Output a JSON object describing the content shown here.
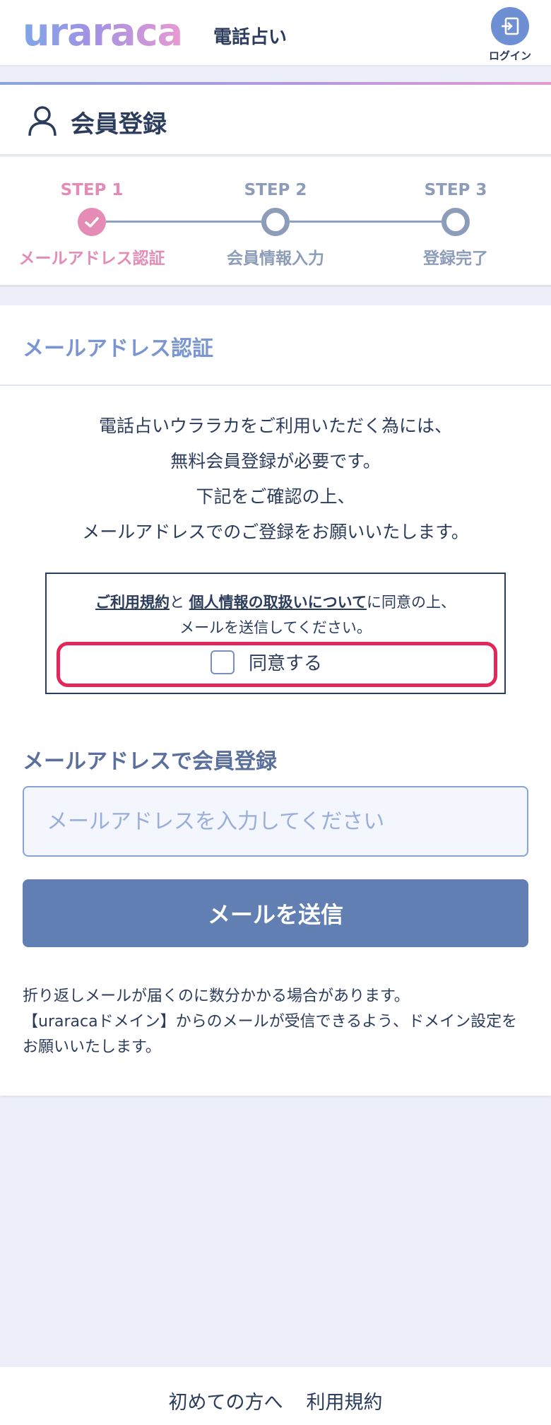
{
  "header": {
    "logo": "uraraca",
    "subtitle": "電話占い",
    "login_label": "ログイン"
  },
  "page_title": "会員登録",
  "steps": [
    {
      "title": "STEP 1",
      "name": "メールアドレス認証",
      "status": "done"
    },
    {
      "title": "STEP 2",
      "name": "会員情報入力",
      "status": "todo"
    },
    {
      "title": "STEP 3",
      "name": "登録完了",
      "status": "todo"
    }
  ],
  "section": {
    "heading": "メールアドレス認証",
    "intro": [
      "電話占いウララカをご利用いただく為には、",
      "無料会員登録が必要です。",
      "下記をご確認の上、",
      "メールアドレスでのご登録をお願いいたします。"
    ]
  },
  "agreement": {
    "terms_link": "ご利用規約",
    "and": "と",
    "privacy_link": "個人情報の取扱いについて",
    "suffix": "に同意の上、",
    "line2": "メールを送信してください。",
    "checkbox_label": "同意する",
    "checked": false
  },
  "email": {
    "heading": "メールアドレスで会員登録",
    "placeholder": "メールアドレスを入力してください",
    "value": "",
    "submit_label": "メールを送信"
  },
  "note": {
    "line1": "折り返しメールが届くのに数分かかる場合があります。",
    "line2": "【uraracaドメイン】からのメールが受信できるよう、ドメイン設定をお願いいたします。"
  },
  "footer": {
    "links": [
      "初めての方へ",
      "利用規約"
    ]
  },
  "colors": {
    "accent": "#617fb2",
    "step_done": "#e58cb6",
    "step_todo": "#8d9cb9",
    "highlight": "#e2275a"
  }
}
